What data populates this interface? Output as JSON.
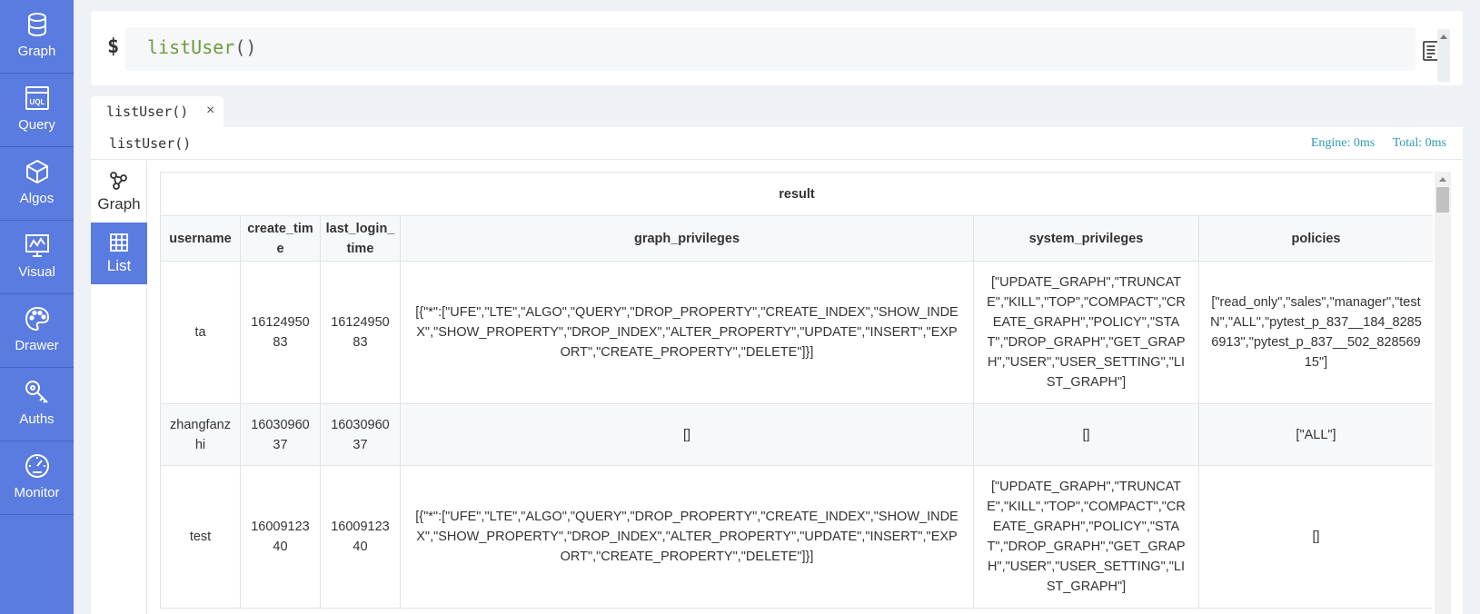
{
  "nav": {
    "items": [
      {
        "label": "Graph",
        "icon": "database-icon"
      },
      {
        "label": "Query",
        "icon": "uql-icon"
      },
      {
        "label": "Algos",
        "icon": "cube-icon"
      },
      {
        "label": "Visual",
        "icon": "monitor-chart-icon"
      },
      {
        "label": "Drawer",
        "icon": "palette-icon"
      },
      {
        "label": "Auths",
        "icon": "key-icon"
      },
      {
        "label": "Monitor",
        "icon": "gauge-icon"
      }
    ]
  },
  "command": {
    "prompt": "$",
    "fn_name": "listUser",
    "parens": "()"
  },
  "tab": {
    "label": "listUser()",
    "close": "×"
  },
  "result": {
    "query": "listUser()",
    "engine": "Engine: 0ms",
    "total": "Total: 0ms"
  },
  "views": {
    "graph": "Graph",
    "list": "List"
  },
  "table": {
    "group_header": "result",
    "columns": [
      "username",
      "create_time",
      "last_login_time",
      "graph_privileges",
      "system_privileges",
      "policies"
    ],
    "rows": [
      {
        "username": "ta",
        "create_time": "1612495083",
        "last_login_time": "1612495083",
        "graph_privileges": "[{\"*\":[\"UFE\",\"LTE\",\"ALGO\",\"QUERY\",\"DROP_PROPERTY\",\"CREATE_INDEX\",\"SHOW_INDEX\",\"SHOW_PROPERTY\",\"DROP_INDEX\",\"ALTER_PROPERTY\",\"UPDATE\",\"INSERT\",\"EXPORT\",\"CREATE_PROPERTY\",\"DELETE\"]}]",
        "system_privileges": "[\"UPDATE_GRAPH\",\"TRUNCATE\",\"KILL\",\"TOP\",\"COMPACT\",\"CREATE_GRAPH\",\"POLICY\",\"STAT\",\"DROP_GRAPH\",\"GET_GRAPH\",\"USER\",\"USER_SETTING\",\"LIST_GRAPH\"]",
        "policies": "[\"read_only\",\"sales\",\"manager\",\"testN\",\"ALL\",\"pytest_p_837__184_82856913\",\"pytest_p_837__502_82856915\"]"
      },
      {
        "username": "zhangfanzhi",
        "create_time": "1603096037",
        "last_login_time": "1603096037",
        "graph_privileges": "[]",
        "system_privileges": "[]",
        "policies": "[\"ALL\"]"
      },
      {
        "username": "test",
        "create_time": "1600912340",
        "last_login_time": "1600912340",
        "graph_privileges": "[{\"*\":[\"UFE\",\"LTE\",\"ALGO\",\"QUERY\",\"DROP_PROPERTY\",\"CREATE_INDEX\",\"SHOW_INDEX\",\"SHOW_PROPERTY\",\"DROP_INDEX\",\"ALTER_PROPERTY\",\"UPDATE\",\"INSERT\",\"EXPORT\",\"CREATE_PROPERTY\",\"DELETE\"]}]",
        "system_privileges": "[\"UPDATE_GRAPH\",\"TRUNCATE\",\"KILL\",\"TOP\",\"COMPACT\",\"CREATE_GRAPH\",\"POLICY\",\"STAT\",\"DROP_GRAPH\",\"GET_GRAPH\",\"USER\",\"USER_SETTING\",\"LIST_GRAPH\"]",
        "policies": "[]"
      }
    ]
  },
  "colors": {
    "nav_bg": "#5a7bdf",
    "accent": "#5a7bdf",
    "timing": "#2e9bb0",
    "fn_name": "#6f9a3b"
  }
}
